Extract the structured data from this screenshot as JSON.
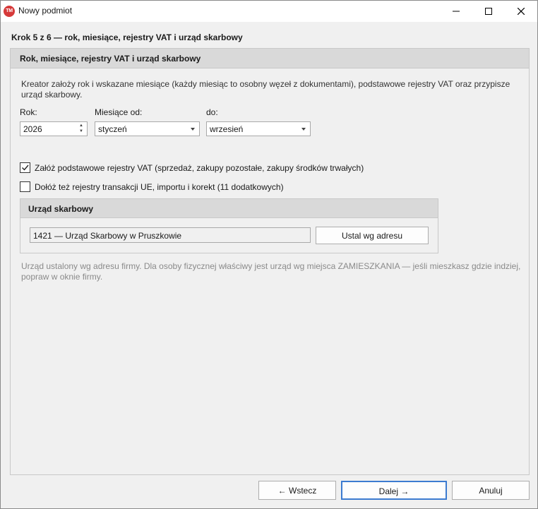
{
  "window": {
    "title": "Nowy podmiot",
    "app_icon_text": "TM"
  },
  "step_title": "Krok 5 z 6 — rok, miesiące, rejestry VAT i urząd skarbowy",
  "panel": {
    "header": "Rok, miesiące, rejestry VAT i urząd skarbowy",
    "description": "Kreator założy rok i wskazane miesiące (każdy miesiąc to osobny węzeł z dokumentami), podstawowe rejestry VAT oraz przypisze urząd skarbowy.",
    "year_label": "Rok:",
    "year_value": "2026",
    "months_from_label": "Miesiące od:",
    "months_from_value": "styczeń",
    "months_to_label": "do:",
    "months_to_value": "wrzesień",
    "checkboxes": [
      {
        "label": "Załóż podstawowe rejestry VAT (sprzedaż, zakupy pozostałe, zakupy środków trwałych)",
        "checked": true
      },
      {
        "label": "Dołóż też rejestry transakcji UE, importu i korekt (11 dodatkowych)",
        "checked": false
      }
    ],
    "tax_office": {
      "header": "Urząd skarbowy",
      "value": "1421 — Urząd Skarbowy w Pruszkowie",
      "button_label": "Ustal wg adresu"
    },
    "hint": "Urząd ustalony wg adresu firmy. Dla osoby fizycznej właściwy jest urząd wg miejsca ZAMIESZKANIA — jeśli mieszkasz gdzie indziej, popraw w oknie firmy."
  },
  "footer": {
    "back_label": "← Wstecz",
    "next_label": "Dalej →",
    "cancel_label": "Anuluj"
  },
  "colors": {
    "app_icon": "#d63a3a",
    "primary_border": "#3c7bd0",
    "header_bg": "#d9d9d9",
    "hint_text": "#8a8a8a"
  }
}
